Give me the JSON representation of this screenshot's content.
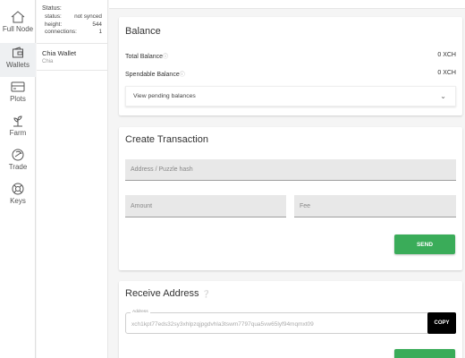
{
  "nav": {
    "items": [
      {
        "label": "Full Node",
        "icon": "home-icon"
      },
      {
        "label": "Wallets",
        "icon": "wallet-icon"
      },
      {
        "label": "Plots",
        "icon": "storage-icon"
      },
      {
        "label": "Farm",
        "icon": "plant-icon"
      },
      {
        "label": "Trade",
        "icon": "trade-icon"
      },
      {
        "label": "Keys",
        "icon": "lifebuoy-icon"
      }
    ],
    "active": "Wallets"
  },
  "status": {
    "title": "Status:",
    "rows": [
      {
        "label": "status:",
        "value": "not synced"
      },
      {
        "label": "height:",
        "value": "544"
      },
      {
        "label": "connections:",
        "value": "1"
      }
    ]
  },
  "wallet": {
    "name": "Chia Wallet",
    "sub": "Chia"
  },
  "balance": {
    "title": "Balance",
    "total_label": "Total Balance",
    "total_value": "0 XCH",
    "spendable_label": "Spendable Balance",
    "spendable_value": "0 XCH",
    "pending_label": "View pending balances"
  },
  "create": {
    "title": "Create Transaction",
    "address_placeholder": "Address / Puzzle hash",
    "amount_placeholder": "Amount",
    "fee_placeholder": "Fee",
    "send_label": "SEND"
  },
  "receive": {
    "title": "Receive Address",
    "address_legend": "Address",
    "address_value": "xch1kpt77eds32sy3xhlpzqjpgdvhla3tswm7797qua5vw65lyf94mqmxt09",
    "copy_label": "COPY"
  },
  "colors": {
    "accent": "#3aac59",
    "copy": "#000000"
  }
}
